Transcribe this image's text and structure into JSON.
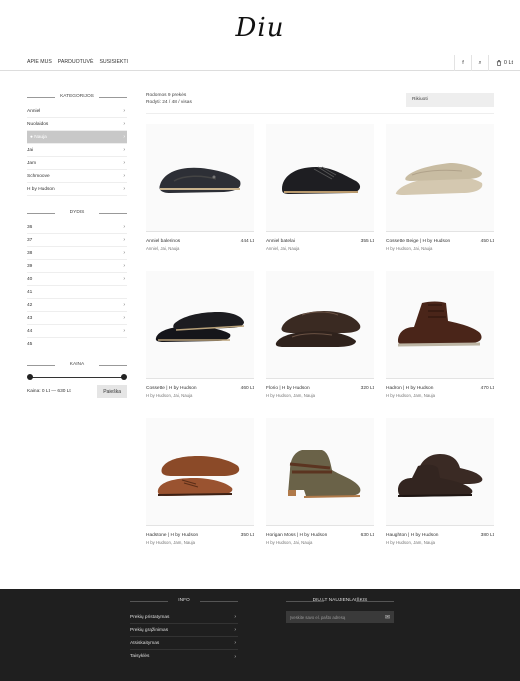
{
  "brand": {
    "logo_text": "Diu"
  },
  "topnav": {
    "links": [
      "APIE MUS",
      "PARDUOTUVĖ",
      "SUSISIEKTI"
    ],
    "facebook_label": "f",
    "search_label": "⌕",
    "cart_label": "0 Lt"
  },
  "sidebar": {
    "categories_title": "KATEGORIJOS",
    "categories": [
      {
        "label": "Anniel",
        "active": false
      },
      {
        "label": "Nuolaidos",
        "active": false
      },
      {
        "label": "Nauja",
        "active": true
      },
      {
        "label": "Jai",
        "active": false
      },
      {
        "label": "Jam",
        "active": false
      },
      {
        "label": "Schmoove",
        "active": false
      },
      {
        "label": "H by Hudson",
        "active": false
      }
    ],
    "sizes_title": "DYDIS",
    "sizes": [
      {
        "label": "36",
        "chevron": true
      },
      {
        "label": "37",
        "chevron": true
      },
      {
        "label": "38",
        "chevron": true
      },
      {
        "label": "39",
        "chevron": true
      },
      {
        "label": "40",
        "chevron": true
      },
      {
        "label": "41",
        "chevron": false
      },
      {
        "label": "42",
        "chevron": true
      },
      {
        "label": "43",
        "chevron": true
      },
      {
        "label": "44",
        "chevron": true
      },
      {
        "label": "45",
        "chevron": false
      }
    ],
    "price_title": "KAINA",
    "price_text": "Kaina: 0 Lt — 630 Lt",
    "filter_label": "Paieška",
    "price_range": {
      "min": 0,
      "max": 630,
      "low": 0,
      "high": 630
    }
  },
  "results": {
    "line1": "Rodomos 9 prekės",
    "line2": "Rodyti: 24 / 48 / visas",
    "sort_label": "Rikiuoti"
  },
  "products": [
    {
      "name": "Anniel balerinos",
      "price": "444 Lt",
      "tags": "Anniel, Jai, Nauja",
      "icon": "ballet-flat"
    },
    {
      "name": "Anniel batelai",
      "price": "355 Lt",
      "tags": "Anniel, Jai, Nauja",
      "icon": "lace-flat"
    },
    {
      "name": "Cossette Beige | H by Hudson",
      "price": "450 Lt",
      "tags": "H by Hudson, Jai, Nauja",
      "icon": "slipper"
    },
    {
      "name": "Cossette | H by Hudson",
      "price": "460 Lt",
      "tags": "H by Hudson, Jai, Nauja",
      "icon": "loafer"
    },
    {
      "name": "Florio | H by Hudson",
      "price": "320 Lt",
      "tags": "H by Hudson, Jam, Nauja",
      "icon": "driving-moc"
    },
    {
      "name": "Hadron | H by Hudson",
      "price": "470 Lt",
      "tags": "H by Hudson, Jam, Nauja",
      "icon": "chukka"
    },
    {
      "name": "Hadstone | H by Hudson",
      "price": "350 Lt",
      "tags": "H by Hudson, Jam, Nauja",
      "icon": "derby"
    },
    {
      "name": "Horigan Moss | H by Hudson",
      "price": "630 Lt",
      "tags": "H by Hudson, Jai, Nauja",
      "icon": "ankle-boot"
    },
    {
      "name": "Haughton | H by Hudson",
      "price": "380 Lt",
      "tags": "H by Hudson, Jam, Nauja",
      "icon": "desert-boot"
    }
  ],
  "footer": {
    "info_title": "INFO",
    "info_items": [
      "Prekių pristatymas",
      "Prekių grąžinimas",
      "Atsiskaitymas",
      "Taisyklės"
    ],
    "news_title": "DIU.LT NAUJIENLAIŠKIS",
    "news_placeholder": "Įveskite savo el. pašto adresą"
  },
  "colors": {
    "footer_bg": "#1f1f1f",
    "active_bg": "#c8c8c8"
  }
}
